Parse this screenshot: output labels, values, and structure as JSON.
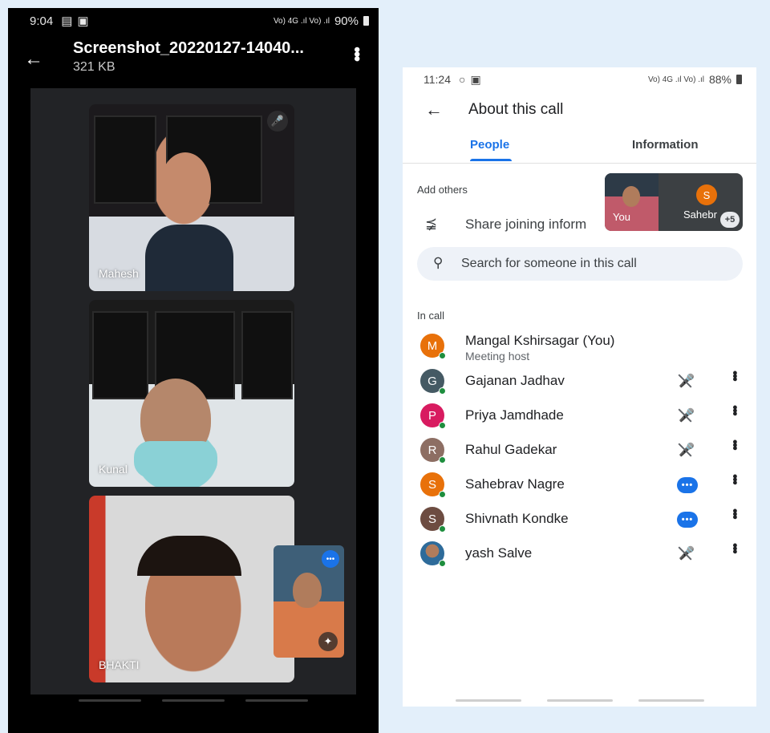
{
  "left_phone": {
    "status": {
      "time": "9:04",
      "network": "Vo) 4G .ıl Vo) .ıl",
      "battery": "90%"
    },
    "header": {
      "title": "Screenshot_20220127-14040...",
      "size": "321 KB"
    },
    "tiles": [
      {
        "name": "Mahesh"
      },
      {
        "name": "Kunal"
      },
      {
        "name": "BHAKTI"
      }
    ]
  },
  "right_phone": {
    "status": {
      "time": "11:24",
      "network": "Vo) 4G .ıl Vo) .ıl",
      "battery": "88%"
    },
    "title": "About this call",
    "tabs": [
      {
        "label": "People",
        "active": true
      },
      {
        "label": "Information",
        "active": false
      }
    ],
    "add_others_label": "Add others",
    "share_label": "Share joining inform",
    "mini_preview": {
      "you_label": "You",
      "other_initial": "S",
      "other_name": "Sahebr",
      "more": "+5"
    },
    "search_placeholder": "Search for someone in this call",
    "in_call_label": "In call",
    "people": [
      {
        "initial": "M",
        "name": "Mangal Kshirsagar (You)",
        "role": "Meeting host",
        "color": "#e8710a",
        "state": "none"
      },
      {
        "initial": "G",
        "name": "Gajanan Jadhav",
        "color": "#455a64",
        "state": "muted"
      },
      {
        "initial": "P",
        "name": "Priya Jamdhade",
        "color": "#d81b60",
        "state": "muted"
      },
      {
        "initial": "R",
        "name": "Rahul Gadekar",
        "color": "#8d6e63",
        "state": "muted"
      },
      {
        "initial": "S",
        "name": "Sahebrav Nagre",
        "color": "#e8710a",
        "state": "speaking"
      },
      {
        "initial": "S",
        "name": "Shivnath Kondke",
        "color": "#6d4c41",
        "state": "speaking"
      },
      {
        "initial": "",
        "name": "yash Salve",
        "color": "#9aa0a6",
        "state": "muted"
      }
    ]
  }
}
